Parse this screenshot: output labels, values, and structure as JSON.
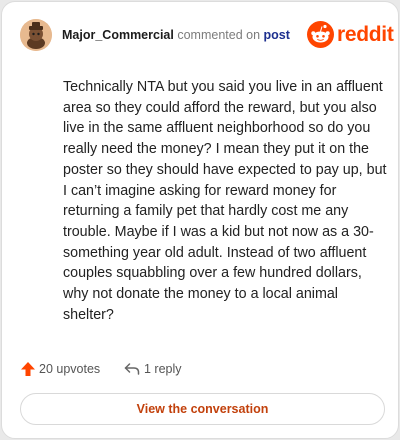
{
  "comment": {
    "username": "Major_Commercial",
    "action_text": "commented on",
    "post_link": "post",
    "body": "Technically NTA but you said you live in an affluent area so they could afford the reward, but you also live in the same affluent neighborhood so do you really need the money? I mean they put it on the poster so they should have expected to pay up, but I can’t imagine asking for reward money for returning a family pet that hardly cost me any trouble. Maybe if I was a kid but not now as a 30-something year old adult. Instead of two affluent couples squabbling over a few hundred dollars, why not donate the money to a local animal shelter?"
  },
  "brand": {
    "name": "reddit",
    "color": "#ff4500"
  },
  "stats": {
    "upvotes": "20 upvotes",
    "replies": "1 reply"
  },
  "cta": {
    "label": "View the conversation"
  },
  "icons": {
    "avatar": "avatar-icon",
    "logo": "reddit-logo-icon",
    "upvote": "upvote-arrow-icon",
    "reply": "reply-arrow-icon"
  }
}
